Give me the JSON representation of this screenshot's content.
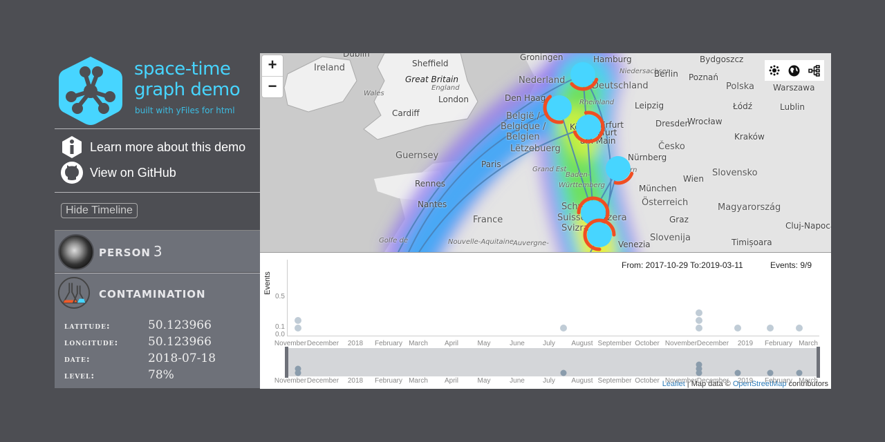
{
  "header": {
    "title_line1": "space-time",
    "title_line2": "graph demo",
    "subtitle": "built with yFiles for html"
  },
  "links": [
    {
      "label": "Learn more about this demo",
      "icon": "info-icon"
    },
    {
      "label": "View on GitHub",
      "icon": "github-icon"
    }
  ],
  "hide_timeline_label": "Hide Timeline",
  "person": {
    "label": "PERSON",
    "number": "3"
  },
  "contamination": {
    "label": "CONTAMINATION",
    "props": [
      {
        "key": "LATITUDE:",
        "value": "50.123966"
      },
      {
        "key": "LONGITUDE:",
        "value": "50.123966"
      },
      {
        "key": "DATE:",
        "value": "2018-07-18"
      },
      {
        "key": "LEVEL:",
        "value": "78%"
      }
    ]
  },
  "map": {
    "zoom_in": "+",
    "zoom_out": "−",
    "tools": [
      "graph-layout-icon",
      "globe-icon",
      "hierarchy-icon"
    ],
    "labels": [
      "Dublin",
      "Ireland",
      "Sheffield",
      "Great Britain",
      "England",
      "Wales",
      "London",
      "Cardiff",
      "Guernsey",
      "Rennes",
      "Nantes",
      "Paris",
      "Grand Est",
      "France",
      "Nouvelle-Aquitaine",
      "Auvergne-",
      "Golfe de",
      "Groningen",
      "Nederland",
      "Den Haag",
      "België /",
      "Belgique /",
      "Belgien",
      "Lëtzebuerg",
      "Hamburg",
      "Niedersachsen",
      "Deutschland",
      "Rheinland",
      "Köln",
      "Frankfurt",
      "am Main",
      "Erfurt",
      "Leipzig",
      "Berlin",
      "Dresden",
      "Nürnberg",
      "Bayern",
      "Baden-",
      "Württemberg",
      "München",
      "Schweiz",
      "Suisse/Svizzera",
      "Svizra",
      "Venezia",
      "Bydgoszcz",
      "Poznań",
      "Polska",
      "Warszawa",
      "Łódź",
      "Lublin",
      "Wrocław",
      "Kraków",
      "Česko",
      "Wien",
      "Slovensko",
      "Österreich",
      "Graz",
      "Magyarország",
      "Cluj-Napoca",
      "Slovenija",
      "Timișoara"
    ],
    "attribution": {
      "leaflet": "Leaflet",
      "sep": " | Map data © ",
      "osm": "OpenStreetMap",
      "tail": " contributors"
    },
    "colors": {
      "node": "#47d5ff",
      "arc": "#f04e23",
      "edge": "#4a7fb5"
    }
  },
  "timeline": {
    "range_text": "From: 2017-10-29 To:2019-03-11",
    "events_text": "Events: 9/9"
  },
  "chart_data": {
    "type": "scatter",
    "ylabel": "Events",
    "yticks": [
      "0.0",
      "0.1",
      "0.5"
    ],
    "ylim": [
      0,
      0.9
    ],
    "xlim": [
      "2017-10-29",
      "2019-03-11"
    ],
    "xticks": [
      "November",
      "December",
      "2018",
      "February",
      "March",
      "April",
      "May",
      "June",
      "July",
      "August",
      "September",
      "October",
      "November",
      "December",
      "2019",
      "February",
      "March"
    ],
    "points": [
      {
        "date": "2017-11-05",
        "y": 0.1
      },
      {
        "date": "2017-11-05",
        "y": 0.2
      },
      {
        "date": "2018-07-18",
        "y": 0.1
      },
      {
        "date": "2018-11-25",
        "y": 0.1
      },
      {
        "date": "2018-11-25",
        "y": 0.2
      },
      {
        "date": "2018-11-25",
        "y": 0.3
      },
      {
        "date": "2019-01-01",
        "y": 0.1
      },
      {
        "date": "2019-02-01",
        "y": 0.1
      },
      {
        "date": "2019-03-01",
        "y": 0.1
      }
    ]
  }
}
